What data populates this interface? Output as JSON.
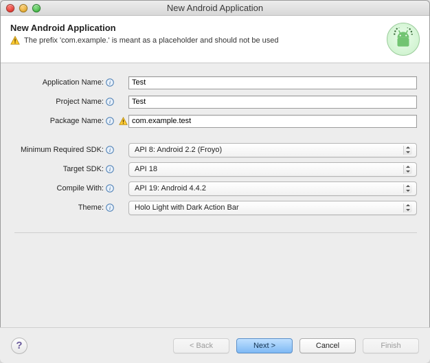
{
  "window": {
    "title": "New Android Application"
  },
  "header": {
    "title": "New Android Application",
    "message": "The prefix 'com.example.' is meant as a placeholder and should not be used"
  },
  "form": {
    "appName": {
      "label": "Application Name:",
      "value": "Test"
    },
    "projectName": {
      "label": "Project Name:",
      "value": "Test"
    },
    "packageName": {
      "label": "Package Name:",
      "value": "com.example.test"
    },
    "minSdk": {
      "label": "Minimum Required SDK:",
      "value": "API 8: Android 2.2 (Froyo)"
    },
    "targetSdk": {
      "label": "Target SDK:",
      "value": "API 18"
    },
    "compileWith": {
      "label": "Compile With:",
      "value": "API 19: Android 4.4.2"
    },
    "theme": {
      "label": "Theme:",
      "value": "Holo Light with Dark Action Bar"
    }
  },
  "footer": {
    "back": "< Back",
    "next": "Next >",
    "cancel": "Cancel",
    "finish": "Finish"
  }
}
